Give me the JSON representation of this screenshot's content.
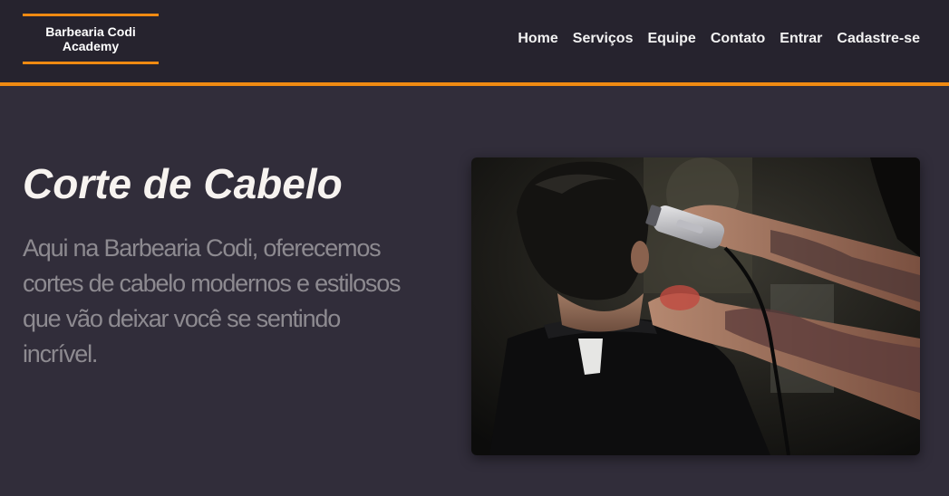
{
  "header": {
    "logo_text": "Barbearia Codi Academy",
    "nav": [
      {
        "label": "Home"
      },
      {
        "label": "Serviços"
      },
      {
        "label": "Equipe"
      },
      {
        "label": "Contato"
      },
      {
        "label": "Entrar"
      },
      {
        "label": "Cadastre-se"
      }
    ]
  },
  "main": {
    "title": "Corte de Cabelo",
    "description": "Aqui na Barbearia Codi, oferecemos cortes de cabelo modernos e estilosos que vão deixar você se sentindo incrível.",
    "image_subject": "barber-cutting-hair-photo"
  },
  "colors": {
    "accent": "#f08a12",
    "header_bg": "#26232e",
    "page_bg": "#312d3a",
    "title": "#f7f3f0",
    "description": "#8d8a90"
  }
}
